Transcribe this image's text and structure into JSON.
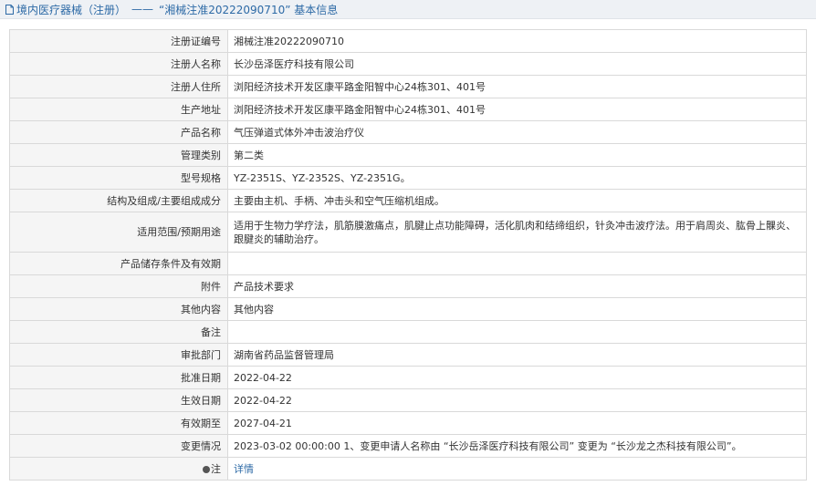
{
  "header": {
    "category": "境内医疗器械（注册）",
    "separator": "——",
    "record_title": "“湘械注准20222090710” 基本信息"
  },
  "rows": [
    {
      "label": "注册证编号",
      "value": "湘械注准20222090710"
    },
    {
      "label": "注册人名称",
      "value": "长沙岳泽医疗科技有限公司"
    },
    {
      "label": "注册人住所",
      "value": "浏阳经济技术开发区康平路金阳智中心24栋301、401号"
    },
    {
      "label": "生产地址",
      "value": "浏阳经济技术开发区康平路金阳智中心24栋301、401号"
    },
    {
      "label": "产品名称",
      "value": "气压弹道式体外冲击波治疗仪"
    },
    {
      "label": "管理类别",
      "value": "第二类"
    },
    {
      "label": "型号规格",
      "value": "YZ-2351S、YZ-2352S、YZ-2351G。"
    },
    {
      "label": "结构及组成/主要组成成分",
      "value": "主要由主机、手柄、冲击头和空气压缩机组成。"
    },
    {
      "label": "适用范围/预期用途",
      "value": "适用于生物力学疗法，肌筋膜激痛点，肌腱止点功能障碍，活化肌肉和结缔组织，针灸冲击波疗法。用于肩周炎、肱骨上髁炎、跟腱炎的辅助治疗。"
    },
    {
      "label": "产品储存条件及有效期",
      "value": ""
    },
    {
      "label": "附件",
      "value": "产品技术要求"
    },
    {
      "label": "其他内容",
      "value": "其他内容"
    },
    {
      "label": "备注",
      "value": ""
    },
    {
      "label": "审批部门",
      "value": "湖南省药品监督管理局"
    },
    {
      "label": "批准日期",
      "value": "2022-04-22"
    },
    {
      "label": "生效日期",
      "value": "2022-04-22"
    },
    {
      "label": "有效期至",
      "value": "2027-04-21"
    },
    {
      "label": "变更情况",
      "value": "2023-03-02 00:00:00 1、变更申请人名称由 “长沙岳泽医疗科技有限公司” 变更为 “长沙龙之杰科技有限公司”。"
    }
  ],
  "note_row": {
    "label": "注",
    "link_text": "详情"
  }
}
